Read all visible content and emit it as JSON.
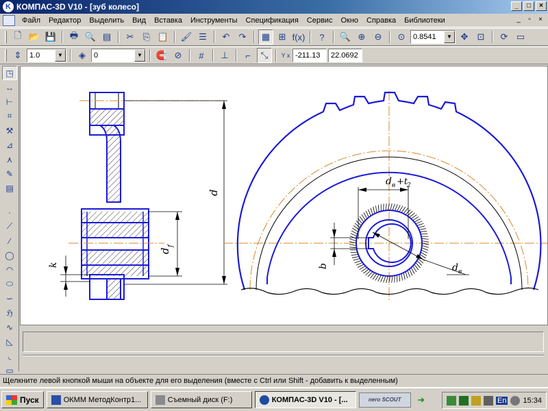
{
  "window": {
    "title": "КОМПАС-3D V10 - [зуб колесо]"
  },
  "menu": [
    "Файл",
    "Редактор",
    "Выделить",
    "Вид",
    "Вставка",
    "Инструменты",
    "Спецификация",
    "Сервис",
    "Окно",
    "Справка",
    "Библиотеки"
  ],
  "toolbar1": {
    "fx_label": "f(x)",
    "zoom_value": "0.8541"
  },
  "toolbar2": {
    "step_value": "1.0",
    "layer_value": "0",
    "coord_x": "-211.13",
    "coord_y": "22.0692",
    "coord_label": "Y x"
  },
  "drawing": {
    "dim_d": "d",
    "dim_df": "d",
    "dim_df_sub": "f",
    "dim_k": "k",
    "dim_b": "b",
    "dim_dv": "d",
    "dim_dv_sub": "в",
    "dim_dvt2": "d",
    "dim_dvt2_sub": "в",
    "dim_dvt2_tail": "+t",
    "dim_dvt2_tsub": "2"
  },
  "status": {
    "text": "Щелкните левой кнопкой мыши на объекте для его выделения (вместе с Ctrl или Shift - добавить к выделенным)"
  },
  "taskbar": {
    "start": "Пуск",
    "items": [
      "ОКММ МетодКонтр1...",
      "Съемный диск (F:)",
      "КОМПАС-3D V10 - [..."
    ],
    "nero": "nero SCOUT",
    "lang": "En",
    "clock": "15:34"
  },
  "colors": {
    "outline": "#1a1ad8",
    "center": "#d8882a",
    "thin": "#000000"
  }
}
